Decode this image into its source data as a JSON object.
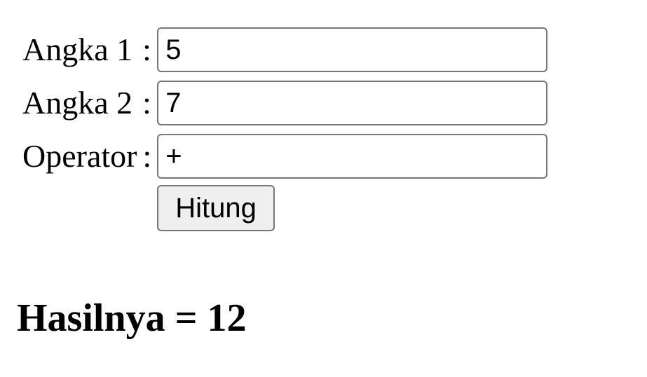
{
  "form": {
    "fields": [
      {
        "label": "Angka 1",
        "value": "5"
      },
      {
        "label": "Angka 2",
        "value": "7"
      },
      {
        "label": "Operator",
        "value": "+"
      }
    ],
    "separator": ":",
    "submit_label": "Hitung"
  },
  "result": {
    "text": "Hasilnya = 12"
  },
  "colors": {
    "background": "#ffffff",
    "input_border": "#767676",
    "button_background": "#efefef"
  }
}
